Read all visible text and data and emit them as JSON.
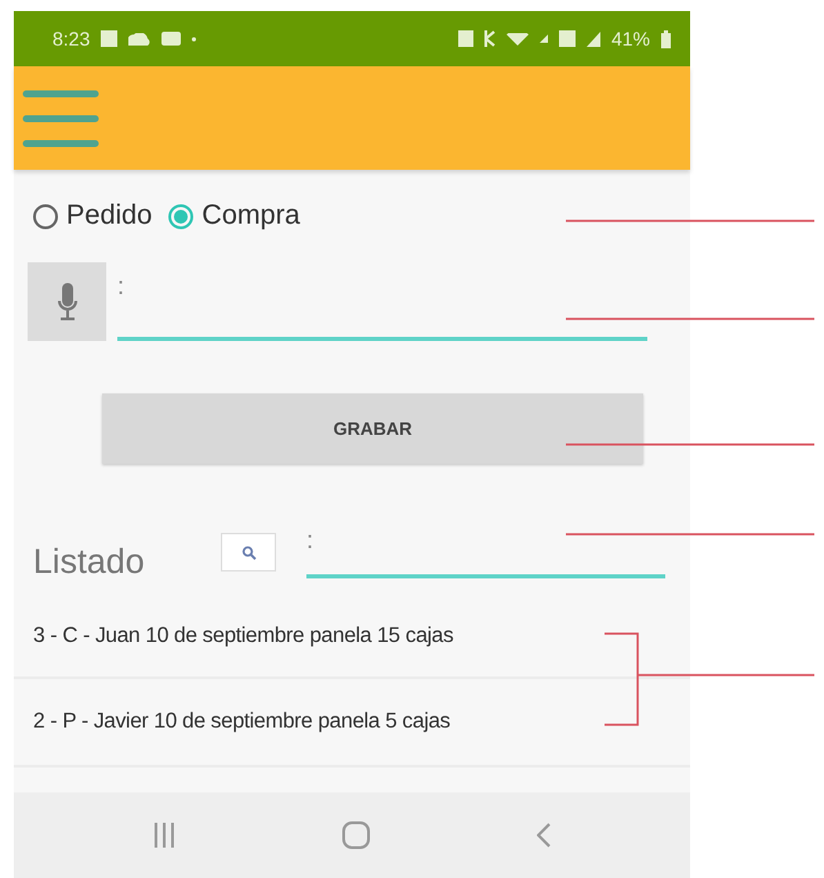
{
  "status_bar": {
    "time": "8:23",
    "battery": "41%"
  },
  "order_type": [
    {
      "label": "Pedido",
      "selected": false
    },
    {
      "label": "Compra",
      "selected": true
    }
  ],
  "voice_field": {
    "label": ":"
  },
  "save_button": {
    "label": "GRABAR"
  },
  "list": {
    "title": "Listado",
    "search_label": ":",
    "rows": [
      "3 - C - Juan 10 de septiembre panela 15 cajas",
      "2 - P - Javier 10 de septiembre panela 5 cajas"
    ]
  }
}
